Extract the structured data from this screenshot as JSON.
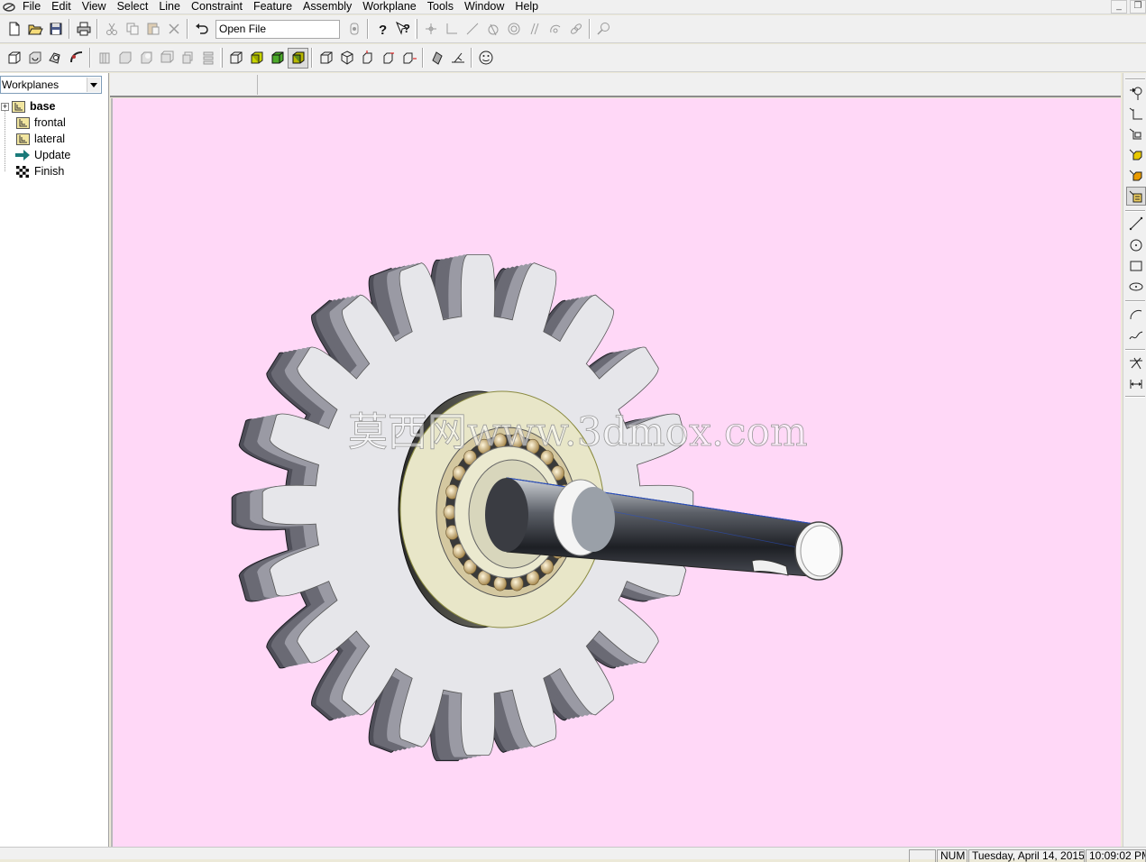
{
  "menubar": {
    "items": [
      "File",
      "Edit",
      "View",
      "Select",
      "Line",
      "Constraint",
      "Feature",
      "Assembly",
      "Workplane",
      "Tools",
      "Window",
      "Help"
    ]
  },
  "window_controls": {
    "minimize": "_",
    "restore": "❐"
  },
  "toolbar1": {
    "command_value": "Open File",
    "buttons": [
      "new-file-icon",
      "open-file-icon",
      "save-icon",
      "print-icon",
      "cut-icon",
      "copy-icon",
      "paste-icon",
      "delete-icon",
      "undo-icon",
      "help-icon",
      "context-help-icon",
      "dimension-icon",
      "angle-dimension-icon",
      "line-constraint-icon",
      "tangent-icon",
      "concentric-icon",
      "parallel-icon",
      "arc-constraint-icon",
      "fix-icon",
      "zoom-icon"
    ]
  },
  "toolbar2": {
    "buttons": [
      "extrude-icon",
      "revolve-icon",
      "sweep-icon",
      "loft-icon",
      "shell-icon",
      "fillet-icon",
      "chamfer-icon",
      "pattern-icon",
      "mirror-icon",
      "wireframe-icon",
      "shaded-icon",
      "shaded-edges-icon",
      "shaded-active-icon",
      "iso-view-icon",
      "front-view-icon",
      "top-view-icon",
      "right-view-icon",
      "side-view-icon",
      "section-icon",
      "measure-icon",
      "smiley-icon"
    ]
  },
  "left_panel": {
    "dropdown_value": "Workplanes",
    "tree": [
      {
        "label": "base",
        "bold": true,
        "icon": "workplane-icon",
        "expandable": true
      },
      {
        "label": "frontal",
        "bold": false,
        "icon": "workplane-icon",
        "expandable": false
      },
      {
        "label": "lateral",
        "bold": false,
        "icon": "workplane-icon",
        "expandable": false
      },
      {
        "label": "Update",
        "bold": false,
        "icon": "update-arrow-icon",
        "expandable": false
      },
      {
        "label": "Finish",
        "bold": false,
        "icon": "finish-flag-icon",
        "expandable": false
      }
    ]
  },
  "viewport": {
    "background": "#ffd8f7",
    "watermark": "莫西网www.3dmox.com",
    "model": "gear-shaft-bearing-assembly"
  },
  "right_toolbar": {
    "buttons": [
      "select-workplane-icon",
      "workplane-axis-icon",
      "workplane-offset-icon",
      "workplane-face-icon",
      "workplane-solid-icon",
      "workplane-active-icon",
      "line-tool-icon",
      "circle-tool-icon",
      "rectangle-tool-icon",
      "ellipse-tool-icon",
      "arc-tool-icon",
      "spline-tool-icon",
      "trim-tool-icon",
      "dimension-tool-icon"
    ]
  },
  "statusbar": {
    "num": "NUM",
    "date": "Tuesday, April 14, 2015",
    "time": "10:09:02 PM"
  },
  "colors": {
    "menu_bg": "#f0f0f0",
    "viewport_bg": "#ffd8f7",
    "gear_face": "#e6e6ea",
    "gear_side": "#5b5b66"
  }
}
